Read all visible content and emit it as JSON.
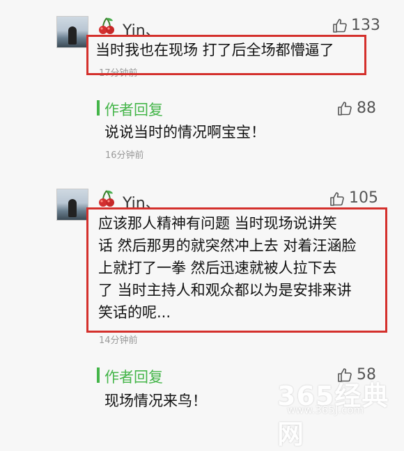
{
  "comments": [
    {
      "username": "Yin、",
      "likes": "133",
      "text": "当时我也在现场 打了后全场都懵逼了",
      "time": "17分钟前",
      "reply": {
        "author_label": "作者回复",
        "likes": "88",
        "text": "说说当时的情况啊宝宝！",
        "time": "16分钟前"
      }
    },
    {
      "username": "Yin、",
      "likes": "105",
      "text_lines": [
        "应该那人精神有问题 当时现场说讲笑",
        "话 然后那男的就突然冲上去 对着汪涵脸",
        "上就打了一拳 然后迅速就被人拉下去",
        "了 当时主持人和观众都以为是安排来讲",
        "笑话的呢..."
      ],
      "time": "14分钟前",
      "reply": {
        "author_label": "作者回复",
        "likes": "58",
        "text": "现场情况来鸟！"
      }
    }
  ],
  "watermark": {
    "main": "365经典网",
    "sub": "www.365J.com"
  },
  "colors": {
    "author_green": "#44b549",
    "highlight_red": "#d4302c"
  },
  "icons": {
    "avatar": "avatar",
    "badge": "cherry-icon",
    "like": "thumbs-up-icon"
  }
}
